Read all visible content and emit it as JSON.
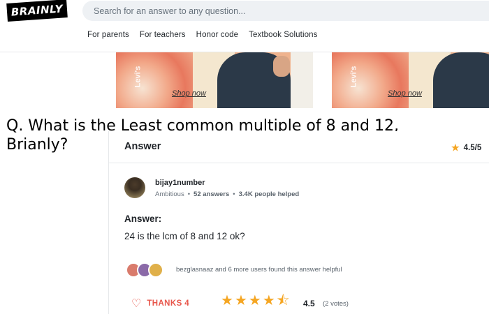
{
  "header": {
    "logo": "BRAINLY",
    "search_placeholder": "Search for an answer to any question...",
    "nav": [
      "For parents",
      "For teachers",
      "Honor code",
      "Textbook Solutions"
    ]
  },
  "ads": [
    {
      "brand": "Levi's",
      "cta": "Shop now"
    },
    {
      "brand": "Levi's",
      "cta": "Shop now"
    }
  ],
  "question": "Q. What is the Least common multiple of 8 and 12, Brianly?",
  "answer_card": {
    "title": "Answer",
    "rating_top": "4.5/5",
    "user": {
      "name": "bijay1number",
      "rank": "Ambitious",
      "answers": "52 answers",
      "helped": "3.4K people helped"
    },
    "answer_label": "Answer:",
    "answer_text": "24 is the lcm of 8 and 12 ok?",
    "helpful_text": "bezglasnaaz and 6 more users found this answer helpful",
    "thanks": "THANKS 4",
    "rating": "4.5",
    "rating_fraction": 0.9,
    "votes": "(2 votes)"
  },
  "colors": {
    "accent_star": "#f5a623",
    "thanks_red": "#e8574c",
    "logo_bg": "#000000"
  },
  "icons": {
    "star": "star-icon",
    "heart": "heart-icon"
  }
}
